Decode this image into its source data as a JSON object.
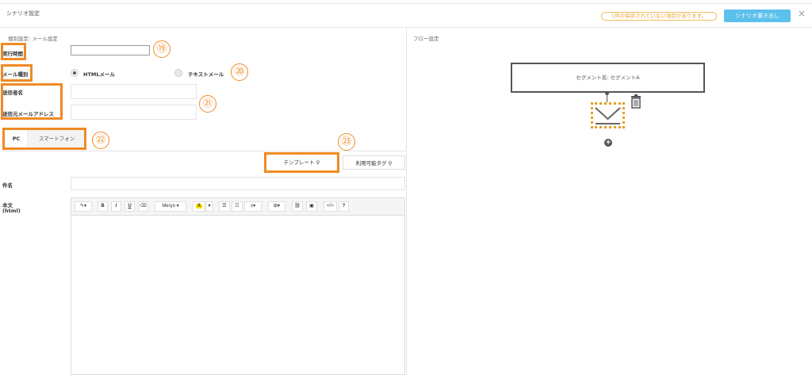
{
  "header": {
    "title": "シナリオ設定",
    "unsaved_notice": "1件の保存されていない項目があります。",
    "export_button": "シナリオ書き出し",
    "close": "×"
  },
  "left": {
    "section_title": "個別設定: メール設定",
    "exec_time_label": "実行時間",
    "mail_type_label": "メール種別",
    "mail_types": [
      "HTMLメール",
      "テキストメール"
    ],
    "sender_name_label": "送信者名",
    "sender_address_label": "送信元メールアドレス",
    "tabs": [
      "PC",
      "スマートフォン"
    ],
    "template_button": "テンプレート",
    "tags_button": "利用可能タグ",
    "subject_label": "件名",
    "body_label": "本文",
    "body_label_sub": "(html)",
    "toolbar": {
      "magic": "✎▾",
      "bold": "B",
      "italic": "I",
      "underline": "U",
      "eraser": "⌫",
      "font": "Meryo ▾",
      "color": "A",
      "color_caret": "▾",
      "ul": "☰",
      "ol": "☷",
      "align": "≡▾",
      "table": "⊞▾",
      "link": "⛓",
      "image": "▣",
      "code": "</>",
      "help": "?"
    }
  },
  "right": {
    "section_title": "フロー設定",
    "segment_label": "セグメント名: セグメントA",
    "add": "+"
  },
  "annotations": [
    "⑲",
    "⑳",
    "㉑",
    "㉒",
    "㉓"
  ],
  "colors": {
    "annotation": "#f08a24",
    "export_button": "#5bc0eb",
    "notice": "#f0a030"
  }
}
